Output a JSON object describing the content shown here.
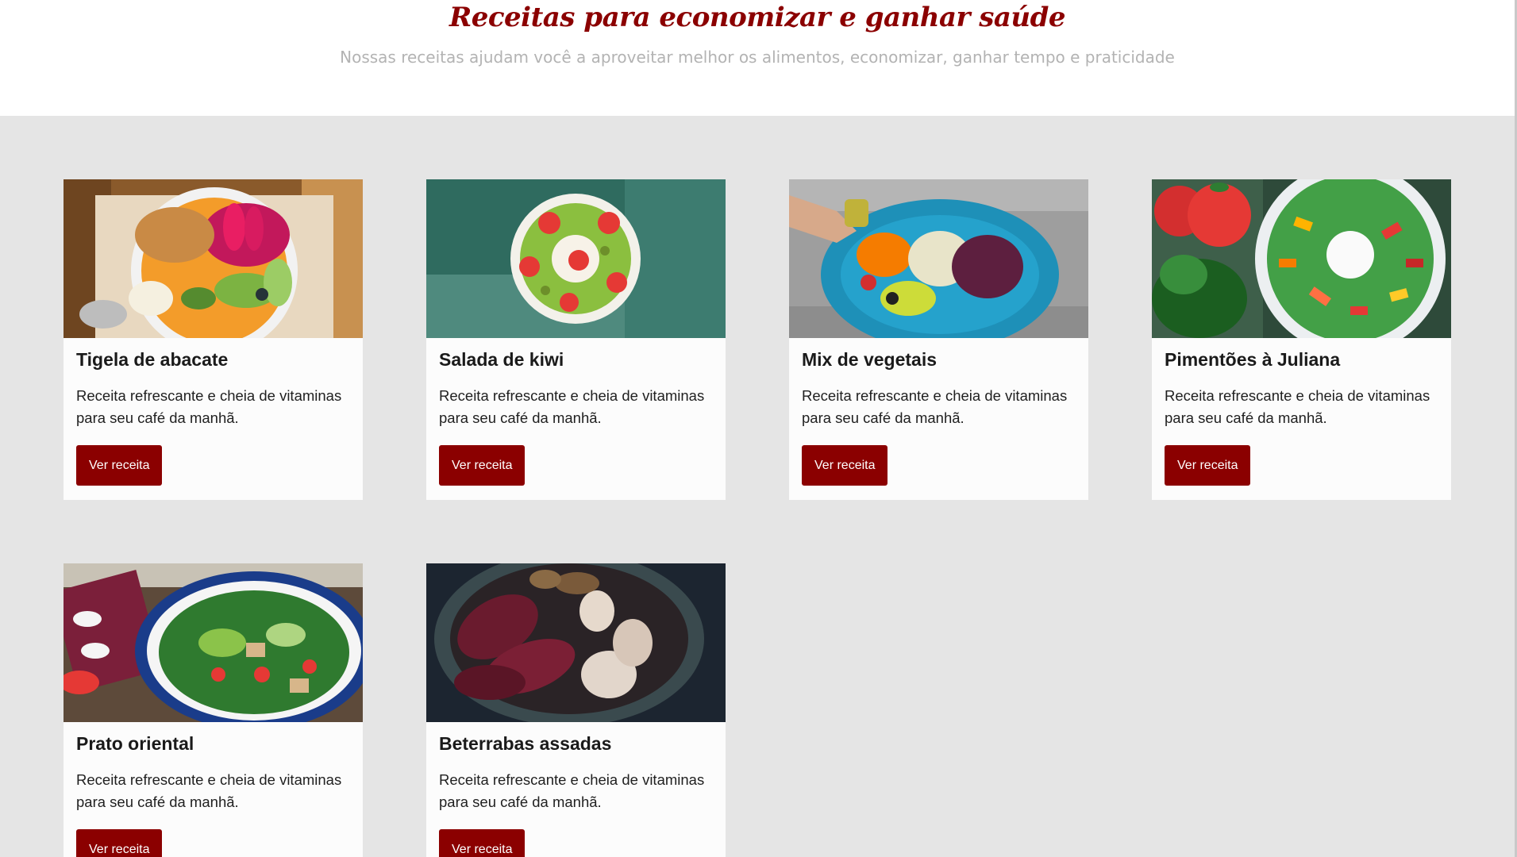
{
  "header": {
    "title": "Receitas para economizar e ganhar saúde",
    "subtitle": "Nossas receitas ajudam você a aproveitar melhor os alimentos, economizar, ganhar tempo e praticidade"
  },
  "colors": {
    "accent": "#8b0000",
    "grid_background": "#e5e5e5",
    "card_background": "#fcfcfc"
  },
  "recipes": [
    {
      "name": "Tigela de abacate",
      "description": "Receita refrescante e cheia de vitaminas para seu café da manhã.",
      "button": "Ver receita",
      "image": "avocado-bowl-photo"
    },
    {
      "name": "Salada de kiwi",
      "description": "Receita refrescante e cheia de vitaminas para seu café da manhã.",
      "button": "Ver receita",
      "image": "kiwi-salad-photo"
    },
    {
      "name": "Mix de vegetais",
      "description": "Receita refrescante e cheia de vitaminas para seu café da manhã.",
      "button": "Ver receita",
      "image": "vegetable-mix-photo"
    },
    {
      "name": "Pimentões à Juliana",
      "description": "Receita refrescante e cheia de vitaminas para seu café da manhã.",
      "button": "Ver receita",
      "image": "julienne-peppers-photo"
    },
    {
      "name": "Prato oriental",
      "description": "Receita refrescante e cheia de vitaminas para seu café da manhã.",
      "button": "Ver receita",
      "image": "oriental-dish-photo"
    },
    {
      "name": "Beterrabas assadas",
      "description": "Receita refrescante e cheia de vitaminas para seu café da manhã.",
      "button": "Ver receita",
      "image": "roasted-beets-photo"
    }
  ]
}
